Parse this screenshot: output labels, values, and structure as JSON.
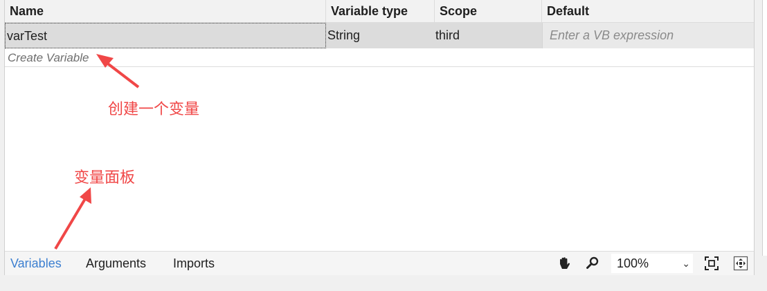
{
  "grid": {
    "columns": [
      "Name",
      "Variable type",
      "Scope",
      "Default"
    ],
    "rows": [
      {
        "name": "varTest",
        "type": "String",
        "scope": "third",
        "default_placeholder": "Enter a VB expression"
      }
    ],
    "create_label": "Create Variable"
  },
  "annotations": {
    "create": "创建一个变量",
    "panel": "变量面板",
    "color": "#f04747"
  },
  "bottom_bar": {
    "tabs": [
      "Variables",
      "Arguments",
      "Imports"
    ],
    "active_tab": "Variables",
    "zoom": "100%",
    "icons": [
      "hand-pan-icon",
      "magnifier-icon",
      "fit-to-screen-icon",
      "overview-icon"
    ]
  },
  "colors": {
    "accent": "#3c7fd0",
    "row_selected": "#dcdcdc"
  }
}
